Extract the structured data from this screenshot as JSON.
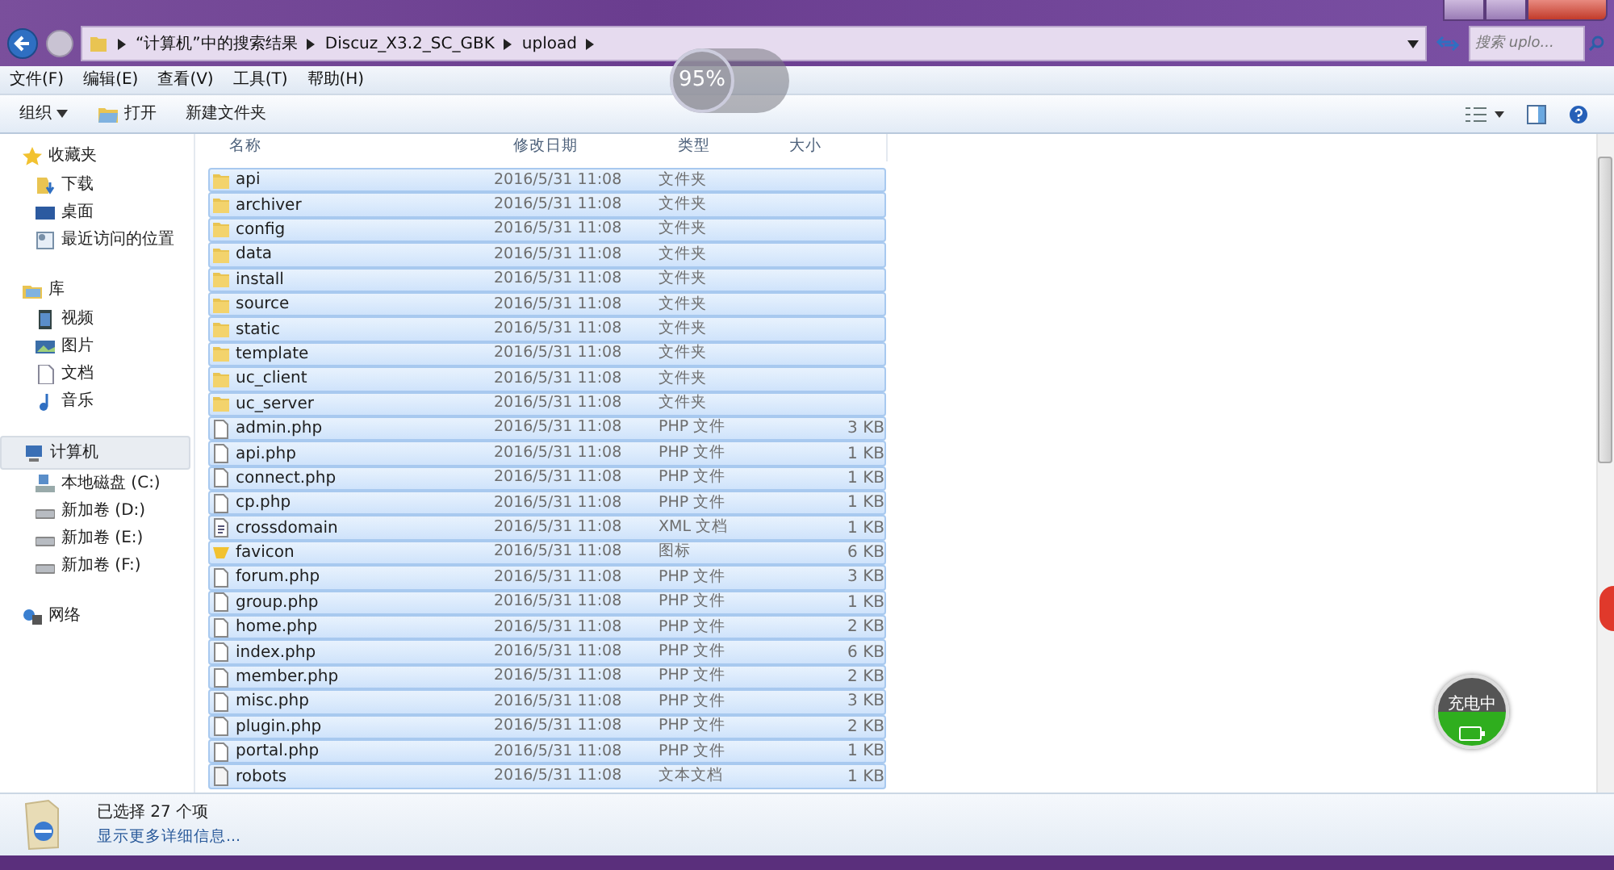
{
  "address": {
    "crumbs": [
      "“计算机”中的搜索结果",
      "Discuz_X3.2_SC_GBK",
      "upload"
    ]
  },
  "search": {
    "placeholder": "搜索 uplo..."
  },
  "menu": [
    "文件(F)",
    "编辑(E)",
    "查看(V)",
    "工具(T)",
    "帮助(H)"
  ],
  "toolbar": [
    {
      "label": "组织",
      "kind": "dropdown"
    },
    {
      "label": "打开",
      "kind": "open"
    },
    {
      "label": "新建文件夹",
      "kind": "plain"
    }
  ],
  "sidebar": {
    "groups": [
      {
        "label": "收藏夹",
        "kind": "star",
        "selected": false,
        "children": [
          {
            "label": "下载",
            "kind": "download"
          },
          {
            "label": "桌面",
            "kind": "desktop"
          },
          {
            "label": "最近访问的位置",
            "kind": "recent"
          }
        ]
      },
      {
        "label": "库",
        "kind": "library",
        "selected": false,
        "children": [
          {
            "label": "视频",
            "kind": "video"
          },
          {
            "label": "图片",
            "kind": "image"
          },
          {
            "label": "文档",
            "kind": "doc"
          },
          {
            "label": "音乐",
            "kind": "music"
          }
        ]
      },
      {
        "label": "计算机",
        "kind": "computer",
        "selected": true,
        "children": [
          {
            "label": "本地磁盘 (C:)",
            "kind": "sysdisk"
          },
          {
            "label": "新加卷 (D:)",
            "kind": "disk"
          },
          {
            "label": "新加卷 (E:)",
            "kind": "disk"
          },
          {
            "label": "新加卷 (F:)",
            "kind": "disk"
          }
        ]
      },
      {
        "label": "网络",
        "kind": "network",
        "selected": false
      }
    ]
  },
  "table": {
    "columns": [
      "名称",
      "修改日期",
      "类型",
      "大小"
    ],
    "rows": [
      {
        "name": "api",
        "date": "2016/5/31 11:08",
        "type": "文件夹",
        "kind": "folder",
        "selected": true
      },
      {
        "name": "archiver",
        "date": "2016/5/31 11:08",
        "type": "文件夹",
        "kind": "folder",
        "selected": true
      },
      {
        "name": "config",
        "date": "2016/5/31 11:08",
        "type": "文件夹",
        "kind": "folder",
        "selected": true
      },
      {
        "name": "data",
        "date": "2016/5/31 11:08",
        "type": "文件夹",
        "kind": "folder",
        "selected": true
      },
      {
        "name": "install",
        "date": "2016/5/31 11:08",
        "type": "文件夹",
        "kind": "folder",
        "selected": true
      },
      {
        "name": "source",
        "date": "2016/5/31 11:08",
        "type": "文件夹",
        "kind": "folder",
        "selected": true
      },
      {
        "name": "static",
        "date": "2016/5/31 11:08",
        "type": "文件夹",
        "kind": "folder",
        "selected": true
      },
      {
        "name": "template",
        "date": "2016/5/31 11:08",
        "type": "文件夹",
        "kind": "folder",
        "selected": true
      },
      {
        "name": "uc_client",
        "date": "2016/5/31 11:08",
        "type": "文件夹",
        "kind": "folder",
        "selected": true
      },
      {
        "name": "uc_server",
        "date": "2016/5/31 11:08",
        "type": "文件夹",
        "kind": "folder",
        "selected": true
      },
      {
        "name": "admin.php",
        "date": "2016/5/31 11:08",
        "type": "PHP 文件",
        "size": "3 KB",
        "kind": "file",
        "selected": true
      },
      {
        "name": "api.php",
        "date": "2016/5/31 11:08",
        "type": "PHP 文件",
        "size": "1 KB",
        "kind": "file",
        "selected": true
      },
      {
        "name": "connect.php",
        "date": "2016/5/31 11:08",
        "type": "PHP 文件",
        "size": "1 KB",
        "kind": "file",
        "selected": true
      },
      {
        "name": "cp.php",
        "date": "2016/5/31 11:08",
        "type": "PHP 文件",
        "size": "1 KB",
        "kind": "file",
        "selected": true
      },
      {
        "name": "crossdomain",
        "date": "2016/5/31 11:08",
        "type": "XML 文档",
        "size": "1 KB",
        "kind": "xml",
        "selected": true
      },
      {
        "name": "favicon",
        "date": "2016/5/31 11:08",
        "type": "图标",
        "size": "6 KB",
        "kind": "icon",
        "selected": true
      },
      {
        "name": "forum.php",
        "date": "2016/5/31 11:08",
        "type": "PHP 文件",
        "size": "3 KB",
        "kind": "file",
        "selected": true
      },
      {
        "name": "group.php",
        "date": "2016/5/31 11:08",
        "type": "PHP 文件",
        "size": "1 KB",
        "kind": "file",
        "selected": true
      },
      {
        "name": "home.php",
        "date": "2016/5/31 11:08",
        "type": "PHP 文件",
        "size": "2 KB",
        "kind": "file",
        "selected": true
      },
      {
        "name": "index.php",
        "date": "2016/5/31 11:08",
        "type": "PHP 文件",
        "size": "6 KB",
        "kind": "file",
        "selected": true
      },
      {
        "name": "member.php",
        "date": "2016/5/31 11:08",
        "type": "PHP 文件",
        "size": "2 KB",
        "kind": "file",
        "selected": true
      },
      {
        "name": "misc.php",
        "date": "2016/5/31 11:08",
        "type": "PHP 文件",
        "size": "3 KB",
        "kind": "file",
        "selected": true
      },
      {
        "name": "plugin.php",
        "date": "2016/5/31 11:08",
        "type": "PHP 文件",
        "size": "2 KB",
        "kind": "file",
        "selected": true
      },
      {
        "name": "portal.php",
        "date": "2016/5/31 11:08",
        "type": "PHP 文件",
        "size": "1 KB",
        "kind": "file",
        "selected": true
      },
      {
        "name": "robots",
        "date": "2016/5/31 11:08",
        "type": "文本文档",
        "size": "1 KB",
        "kind": "text",
        "selected": true
      }
    ]
  },
  "status": {
    "summary": "已选择 27 个项",
    "details_link": "显示更多详细信息..."
  },
  "overlays": {
    "gauge": "95%",
    "charging": "充电中"
  }
}
